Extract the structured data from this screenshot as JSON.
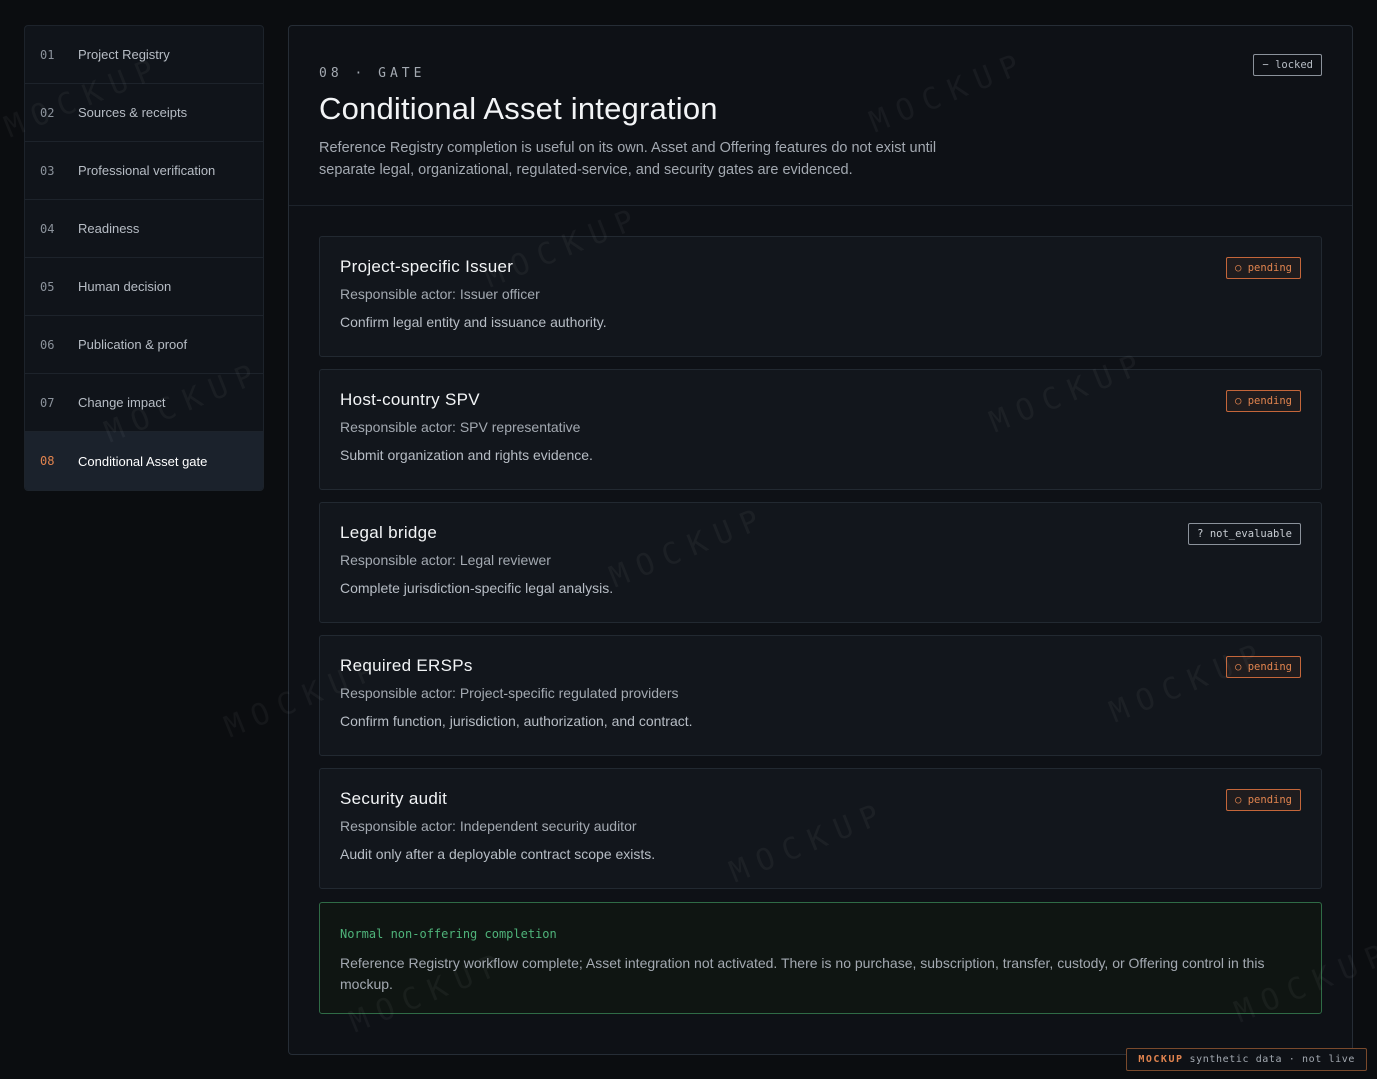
{
  "sidebar": {
    "items": [
      {
        "num": "01",
        "label": "Project Registry"
      },
      {
        "num": "02",
        "label": "Sources & receipts"
      },
      {
        "num": "03",
        "label": "Professional verification"
      },
      {
        "num": "04",
        "label": "Readiness"
      },
      {
        "num": "05",
        "label": "Human decision"
      },
      {
        "num": "06",
        "label": "Publication & proof"
      },
      {
        "num": "07",
        "label": "Change impact"
      },
      {
        "num": "08",
        "label": "Conditional Asset gate"
      }
    ]
  },
  "header": {
    "eyebrow": "08 · GATE",
    "title": "Conditional Asset integration",
    "description": "Reference Registry completion is useful on its own. Asset and Offering features do not exist until separate legal, organizational, regulated-service, and security gates are evidenced.",
    "status_badge": "− locked"
  },
  "gates": [
    {
      "title": "Project-specific Issuer",
      "actor": "Responsible actor: Issuer officer",
      "note": "Confirm legal entity and issuance authority.",
      "badge": "○ pending"
    },
    {
      "title": "Host-country SPV",
      "actor": "Responsible actor: SPV representative",
      "note": "Submit organization and rights evidence.",
      "badge": "○ pending"
    },
    {
      "title": "Legal bridge",
      "actor": "Responsible actor: Legal reviewer",
      "note": "Complete jurisdiction-specific legal analysis.",
      "badge": "? not_evaluable"
    },
    {
      "title": "Required ERSPs",
      "actor": "Responsible actor: Project-specific regulated providers",
      "note": "Confirm function, jurisdiction, authorization, and contract.",
      "badge": "○ pending"
    },
    {
      "title": "Security audit",
      "actor": "Responsible actor: Independent security auditor",
      "note": "Audit only after a deployable contract scope exists.",
      "badge": "○ pending"
    }
  ],
  "completion": {
    "title": "Normal non-offering completion",
    "text": "Reference Registry workflow complete; Asset integration not activated. There is no purchase, subscription, transfer, custody, or Offering control in this mockup."
  },
  "footer": {
    "strong": "MOCKUP",
    "text": "synthetic data · not live"
  },
  "watermark": "MOCKUP",
  "colors": {
    "accent": "#e0834e",
    "success": "#4fb37a",
    "background": "#0b0d10"
  }
}
